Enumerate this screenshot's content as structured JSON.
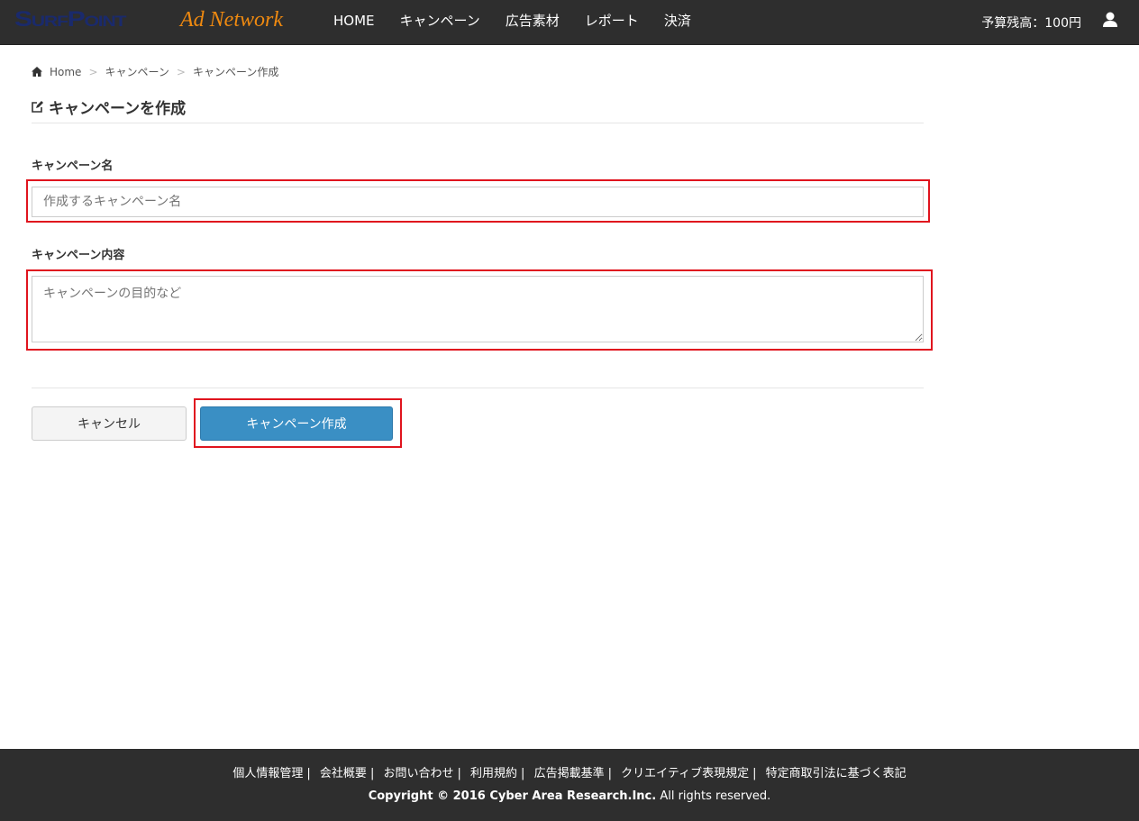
{
  "header": {
    "logo_main": "SurfPoint",
    "logo_sub": "Ad Network",
    "menu": [
      "HOME",
      "キャンペーン",
      "広告素材",
      "レポート",
      "決済"
    ],
    "budget": "予算残高：100円"
  },
  "breadcrumb": [
    "Home",
    "キャンペーン",
    "キャンペーン作成"
  ],
  "page_title": "キャンペーンを作成",
  "form": {
    "name_label": "キャンペーン名",
    "name_placeholder": "作成するキャンペーン名",
    "desc_label": "キャンペーン内容",
    "desc_placeholder": "キャンペーンの目的など",
    "cancel": "キャンセル",
    "submit": "キャンペーン作成"
  },
  "footer": {
    "links": [
      "個人情報管理",
      "会社概要",
      "お問い合わせ",
      "利用規約",
      "広告掲載基準",
      "クリエイティブ表現規定",
      "特定商取引法に基づく表記"
    ],
    "copyright_bold": "Copyright © 2016 Cyber Area Research.Inc.",
    "copyright_rest": " All rights reserved."
  },
  "colors": {
    "highlight": "#e0141e",
    "primary": "#3a8fc4",
    "logo_orange": "#f08a10"
  }
}
